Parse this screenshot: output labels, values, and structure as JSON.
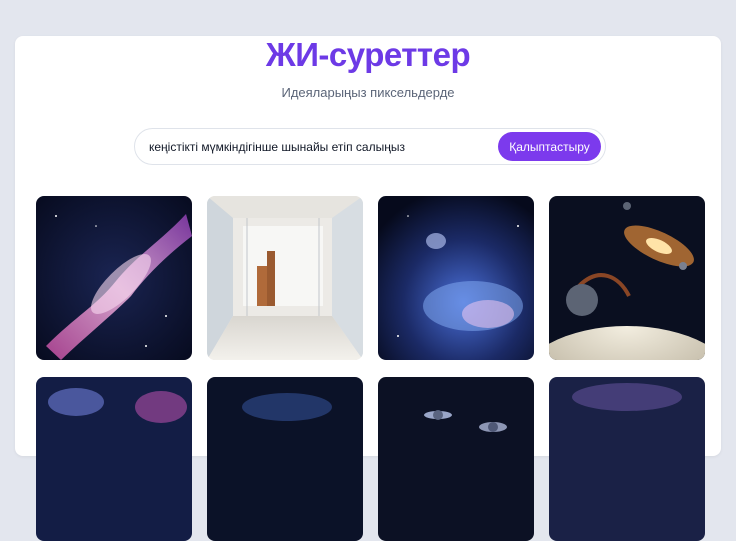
{
  "header": {
    "title": "ЖИ-суреттер",
    "subtitle": "Идеяларыңыз пиксельдерде"
  },
  "search": {
    "value": "кеңістікті мүмкіндігінше шынайы етіп салыңыз",
    "button_label": "Қалыптастыру"
  },
  "colors": {
    "accent": "#7c3aed",
    "title": "#6d3ae6",
    "background": "#e3e6ee"
  },
  "gallery": {
    "images": [
      {
        "subject": "pink-purple nebula"
      },
      {
        "subject": "bright modern interior hall"
      },
      {
        "subject": "blue nebula cloud"
      },
      {
        "subject": "galaxy with planets"
      },
      {
        "subject": "nebula"
      },
      {
        "subject": "nebula"
      },
      {
        "subject": "space with planets"
      },
      {
        "subject": "nebula"
      }
    ]
  }
}
